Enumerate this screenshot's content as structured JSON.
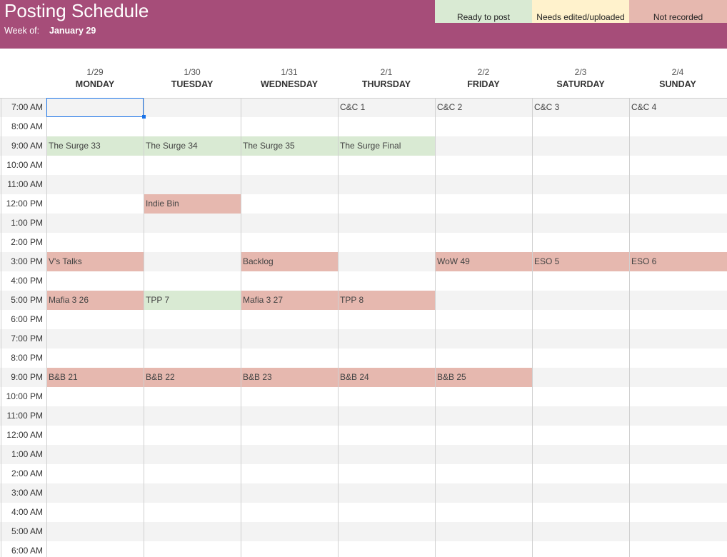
{
  "header": {
    "title": "Posting Schedule",
    "week_of_label": "Week of:",
    "week_of_value": "January 29"
  },
  "legend": [
    {
      "label": "Ready to post",
      "color": "#d9ead3"
    },
    {
      "label": "Needs edited/uploaded",
      "color": "#fff2cc"
    },
    {
      "label": "Not recorded",
      "color": "#e6b8af"
    }
  ],
  "days": [
    {
      "date": "1/29",
      "name": "MONDAY"
    },
    {
      "date": "1/30",
      "name": "TUESDAY"
    },
    {
      "date": "1/31",
      "name": "WEDNESDAY"
    },
    {
      "date": "2/1",
      "name": "THURSDAY"
    },
    {
      "date": "2/2",
      "name": "FRIDAY"
    },
    {
      "date": "2/3",
      "name": "SATURDAY"
    },
    {
      "date": "2/4",
      "name": "SUNDAY"
    }
  ],
  "times": [
    "7:00 AM",
    "8:00 AM",
    "9:00 AM",
    "10:00 AM",
    "11:00 AM",
    "12:00 PM",
    "1:00 PM",
    "2:00 PM",
    "3:00 PM",
    "4:00 PM",
    "5:00 PM",
    "6:00 PM",
    "7:00 PM",
    "8:00 PM",
    "9:00 PM",
    "10:00 PM",
    "11:00 PM",
    "12:00 AM",
    "1:00 AM",
    "2:00 AM",
    "3:00 AM",
    "4:00 AM",
    "5:00 AM",
    "6:00 AM"
  ],
  "status_colors": {
    "ready": "#d9ead3",
    "needs": "#fff2cc",
    "notrec": "#e6b8af"
  },
  "events": [
    {
      "time": "7:00 AM",
      "day": 3,
      "label": "C&C 1",
      "status": ""
    },
    {
      "time": "7:00 AM",
      "day": 4,
      "label": "C&C 2",
      "status": ""
    },
    {
      "time": "7:00 AM",
      "day": 5,
      "label": "C&C 3",
      "status": ""
    },
    {
      "time": "7:00 AM",
      "day": 6,
      "label": "C&C 4",
      "status": ""
    },
    {
      "time": "9:00 AM",
      "day": 0,
      "label": "The Surge 33",
      "status": "ready"
    },
    {
      "time": "9:00 AM",
      "day": 1,
      "label": "The Surge 34",
      "status": "ready"
    },
    {
      "time": "9:00 AM",
      "day": 2,
      "label": "The Surge 35",
      "status": "ready"
    },
    {
      "time": "9:00 AM",
      "day": 3,
      "label": "The Surge Final",
      "status": "ready"
    },
    {
      "time": "12:00 PM",
      "day": 1,
      "label": "Indie Bin",
      "status": "notrec"
    },
    {
      "time": "3:00 PM",
      "day": 0,
      "label": "V's Talks",
      "status": "notrec"
    },
    {
      "time": "3:00 PM",
      "day": 2,
      "label": "Backlog",
      "status": "notrec"
    },
    {
      "time": "3:00 PM",
      "day": 4,
      "label": "WoW 49",
      "status": "notrec"
    },
    {
      "time": "3:00 PM",
      "day": 5,
      "label": "ESO 5",
      "status": "notrec"
    },
    {
      "time": "3:00 PM",
      "day": 6,
      "label": "ESO 6",
      "status": "notrec"
    },
    {
      "time": "5:00 PM",
      "day": 0,
      "label": "Mafia 3 26",
      "status": "notrec"
    },
    {
      "time": "5:00 PM",
      "day": 1,
      "label": "TPP 7",
      "status": "ready"
    },
    {
      "time": "5:00 PM",
      "day": 2,
      "label": "Mafia 3 27",
      "status": "notrec"
    },
    {
      "time": "5:00 PM",
      "day": 3,
      "label": "TPP 8",
      "status": "notrec"
    },
    {
      "time": "9:00 PM",
      "day": 0,
      "label": "B&B 21",
      "status": "notrec"
    },
    {
      "time": "9:00 PM",
      "day": 1,
      "label": "B&B 22",
      "status": "notrec"
    },
    {
      "time": "9:00 PM",
      "day": 2,
      "label": "B&B 23",
      "status": "notrec"
    },
    {
      "time": "9:00 PM",
      "day": 3,
      "label": "B&B 24",
      "status": "notrec"
    },
    {
      "time": "9:00 PM",
      "day": 4,
      "label": "B&B 25",
      "status": "notrec"
    }
  ]
}
